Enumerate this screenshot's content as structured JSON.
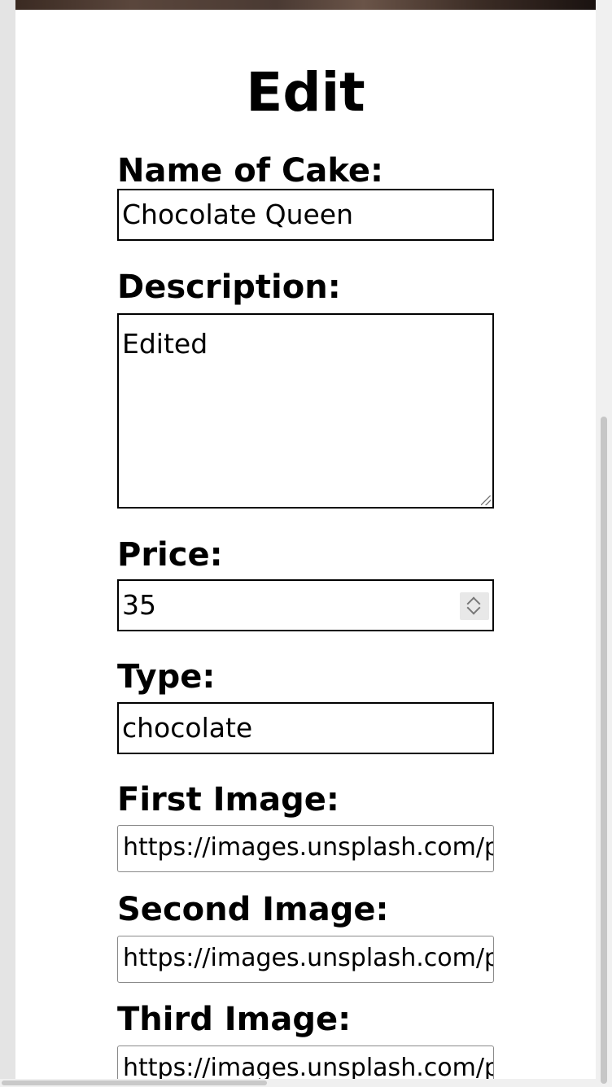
{
  "form": {
    "title": "Edit",
    "name_label": "Name of Cake:",
    "name_value": "Chocolate Queen",
    "description_label": "Description:",
    "description_value": "Edited",
    "price_label": "Price:",
    "price_value": "35",
    "type_label": "Type:",
    "type_value": "chocolate",
    "first_image_label": "First Image:",
    "first_image_value": "https://images.unsplash.com/ph",
    "second_image_label": "Second Image:",
    "second_image_value": "https://images.unsplash.com/ph",
    "third_image_label": "Third Image:",
    "third_image_value": "https://images.unsplash.com/ph"
  },
  "icons": {
    "spinner": "up-down-chevron-icon",
    "resize": "resize-grip-icon"
  }
}
